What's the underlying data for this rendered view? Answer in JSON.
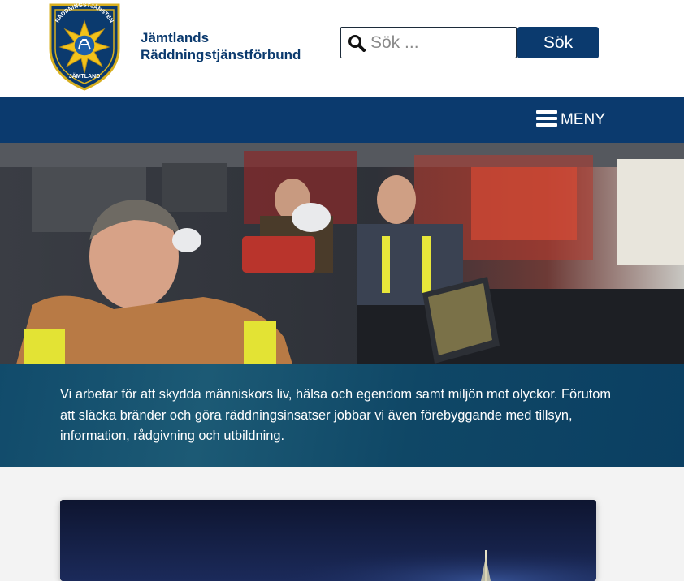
{
  "header": {
    "logo": {
      "icon": "emblem-icon",
      "seal_text_top": "RÄDDNINGSTJÄNSTEN",
      "seal_text_bottom": "JÄMTLAND"
    },
    "org_name_line1": "Jämtlands",
    "org_name_line2": "Räddningstjänstförbund",
    "search": {
      "icon": "search-icon",
      "placeholder": "Sök ...",
      "value": "",
      "button_label": "Sök"
    }
  },
  "nav": {
    "menu_icon": "hamburger-icon",
    "menu_label": "MENY"
  },
  "hero": {
    "image": "firefighters-in-fire-truck-photo"
  },
  "intro": {
    "text": "Vi arbetar för att skydda människors liv, hälsa och egendom samt miljön mot olyckor. Förutom att släcka bränder och göra räddningsinsatser jobbar vi även förebyggande med tillsyn, information, rådgivning och utbildning."
  },
  "featured": {
    "image": "night-sky-tower-photo"
  },
  "colors": {
    "brand_navy": "#0b3a6e",
    "intro_band": "#114b6b",
    "white": "#ffffff"
  }
}
